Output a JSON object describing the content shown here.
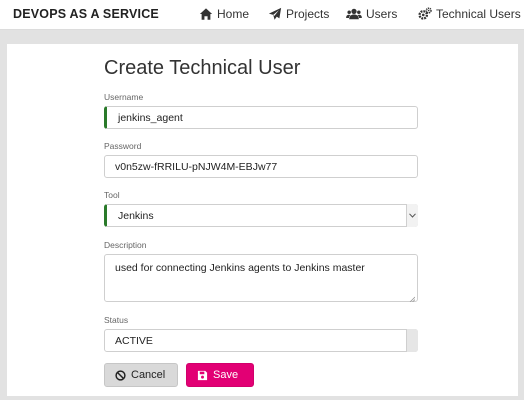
{
  "navbar": {
    "brand": "DEVOPS AS A SERVICE",
    "items": [
      {
        "label": "Home",
        "icon": "home-icon"
      },
      {
        "label": "Projects",
        "icon": "paper-plane-icon"
      },
      {
        "label": "Users",
        "icon": "users-icon"
      },
      {
        "label": "Technical Users",
        "icon": "cogs-icon"
      }
    ]
  },
  "form": {
    "title": "Create Technical User",
    "username": {
      "label": "Username",
      "value": "jenkins_agent"
    },
    "password": {
      "label": "Password",
      "value": "v0n5zw-fRRILU-pNJW4M-EBJw77"
    },
    "tool": {
      "label": "Tool",
      "value": "Jenkins"
    },
    "description": {
      "label": "Description",
      "value": "used for connecting Jenkins agents to Jenkins master"
    },
    "status": {
      "label": "Status",
      "value": "ACTIVE"
    }
  },
  "buttons": {
    "cancel": {
      "label": "Cancel",
      "icon": "ban-icon"
    },
    "save": {
      "label": "Save",
      "icon": "floppy-disk-icon"
    }
  },
  "colors": {
    "accent": "#e20074",
    "valid_border": "#2a7a2a",
    "background": "#e2e2e2"
  }
}
